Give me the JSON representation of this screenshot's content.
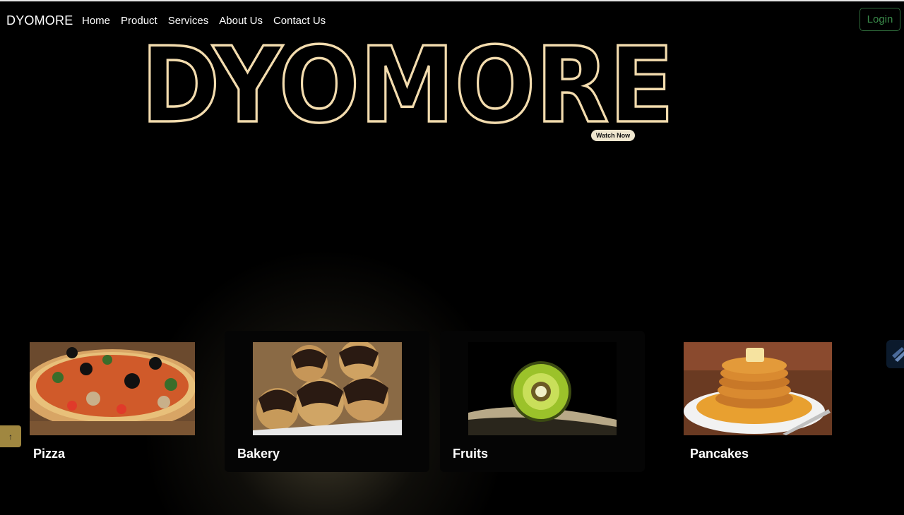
{
  "nav": {
    "brand": "DYOMORE",
    "links": [
      "Home",
      "Product",
      "Services",
      "About Us",
      "Contact Us"
    ],
    "login": "Login"
  },
  "hero": {
    "title": "DYOMORE",
    "watch_button": "Watch Now"
  },
  "cards": [
    {
      "label": "Pizza"
    },
    {
      "label": "Bakery"
    },
    {
      "label": "Fruits"
    },
    {
      "label": "Pancakes"
    }
  ],
  "back_to_top": "↑",
  "colors": {
    "outline": "#f3dcae",
    "login_border": "#2f6b3b",
    "watch_bg": "#efe6cf",
    "back_to_top_bg": "#a08740"
  }
}
